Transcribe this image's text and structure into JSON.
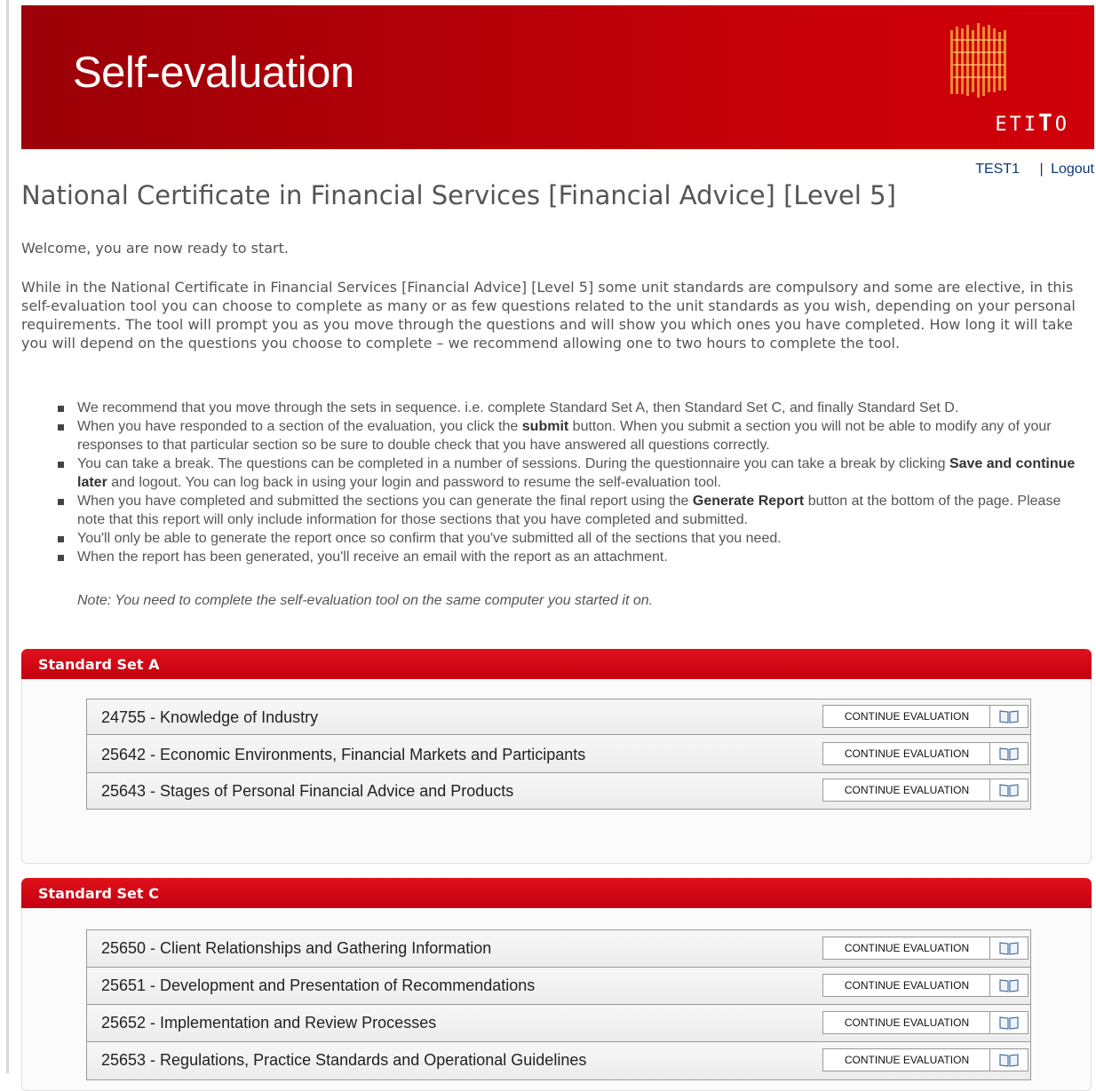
{
  "banner": {
    "title": "Self-evaluation",
    "logo_text_prefix": "ETI",
    "logo_text_bold": "T",
    "logo_text_suffix": "O"
  },
  "user": {
    "name": "TEST1",
    "separator": "|",
    "logout": "Logout"
  },
  "page_title": "National Certificate in Financial Services [Financial Advice] [Level 5]",
  "welcome": "Welcome, you are now ready to start.",
  "intro": "While in the National Certificate in Financial Services [Financial Advice] [Level 5] some unit standards are compulsory and some are elective, in this self-evaluation tool you can choose to complete as many or as few questions related to the unit standards as you wish, depending on your personal requirements.  The tool will prompt you as you move through the questions and will show you which ones you have completed.  How long it will take you will depend on the questions you choose to complete – we recommend allowing one to two hours to complete the tool.",
  "bullets": {
    "b1": "We recommend that you move through the sets in sequence. i.e. complete Standard Set A, then Standard Set C, and finally Standard Set D.",
    "b2_pre": "When you have responded to a section of the evaluation, you click the ",
    "b2_bold": "submit",
    "b2_post": " button.  When you submit a section you will not be able to modify any of your responses to that particular section so be sure to double check that you have answered all questions correctly.",
    "b3_pre": "You can take a break.  The questions can be completed in a number of sessions.  During the questionnaire you can take a break by clicking ",
    "b3_bold": "Save and continue later",
    "b3_post": " and logout.  You can log back in using your login and password to resume the self-evaluation tool.",
    "b4_pre": "When you have completed and submitted the sections you can generate the final report using the ",
    "b4_bold": "Generate Report",
    "b4_post": " button at the bottom of the page.  Please note that this report will only include information for those sections that you have completed and submitted.",
    "b5": "You'll only be able to generate the report once so confirm that you've submitted all of the sections that you need.",
    "b6": "When the report has been generated, you'll receive an email with the report as an attachment."
  },
  "note": "Note: You need to complete the self-evaluation tool on the same computer you started it on.",
  "set_a": {
    "title": "Standard Set A",
    "units": [
      {
        "name": "24755 - Knowledge of Industry",
        "action": "CONTINUE  EVALUATION"
      },
      {
        "name": "25642 - Economic Environments, Financial Markets and Participants",
        "action": "CONTINUE  EVALUATION"
      },
      {
        "name": "25643 - Stages of Personal Financial Advice and Products",
        "action": "CONTINUE  EVALUATION"
      }
    ]
  },
  "set_c": {
    "title": "Standard Set C",
    "units": [
      {
        "name": "25650 - Client Relationships and Gathering Information",
        "action": "CONTINUE  EVALUATION"
      },
      {
        "name": "25651 - Development and Presentation of Recommendations",
        "action": "CONTINUE  EVALUATION"
      },
      {
        "name": "25652 - Implementation and Review Processes",
        "action": "CONTINUE  EVALUATION"
      },
      {
        "name": "25653 - Regulations, Practice Standards and Operational Guidelines",
        "action": "CONTINUE  EVALUATION"
      }
    ]
  },
  "colors": {
    "banner_red": "#b30008",
    "panel_header_red": "#d40015",
    "link_blue": "#0d3a7a"
  },
  "icons": {
    "unit_book": "book-icon",
    "logo": "etito-cube-logo"
  }
}
